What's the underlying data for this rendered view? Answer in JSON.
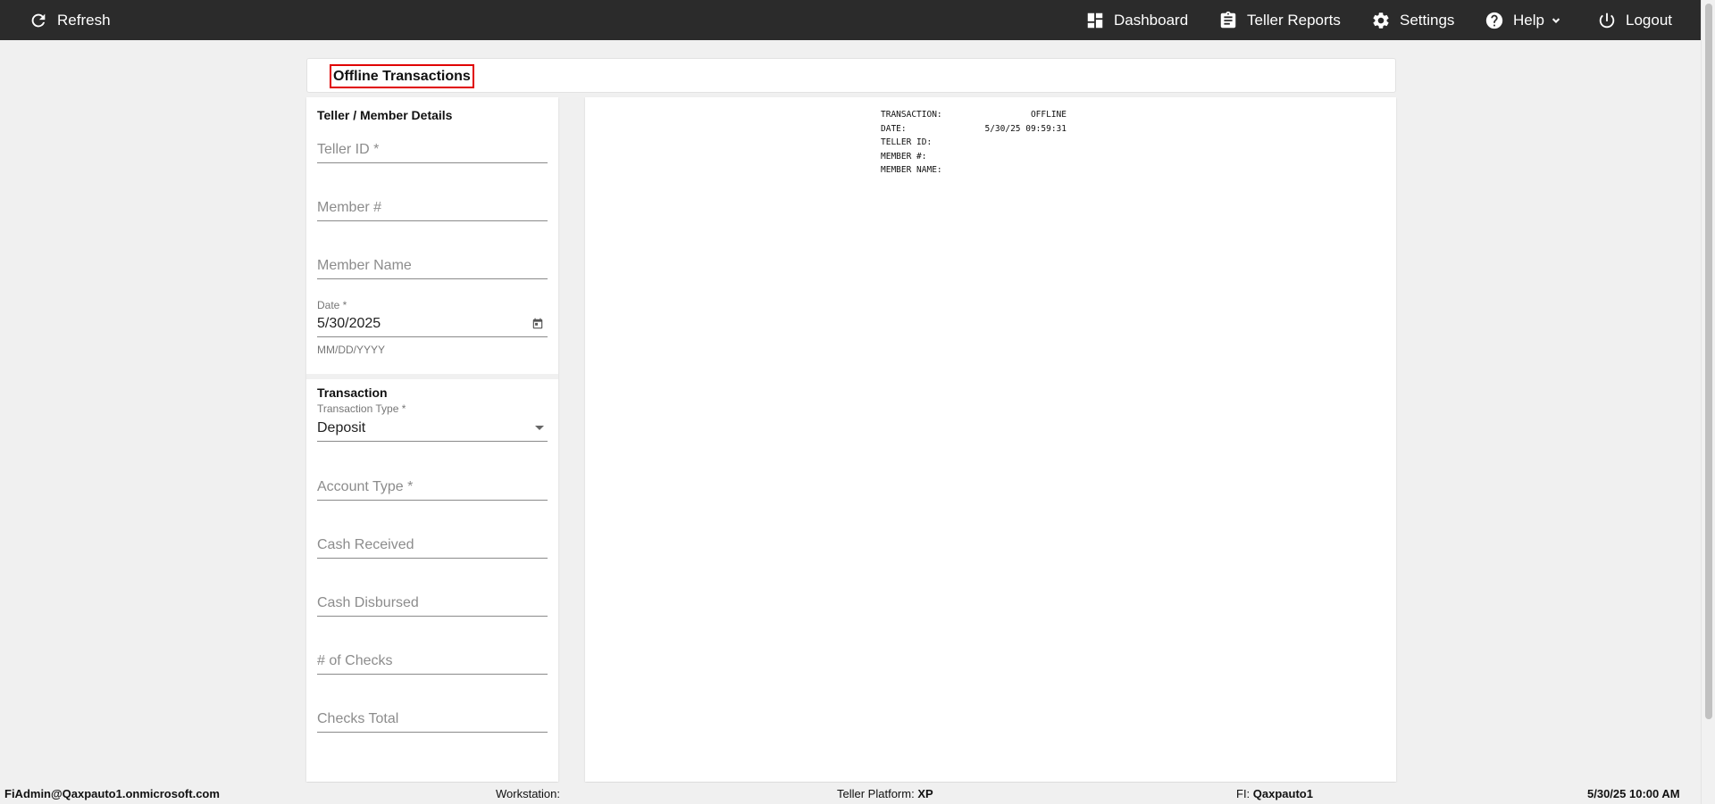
{
  "topbar": {
    "refresh_label": "Refresh",
    "nav": {
      "dashboard": "Dashboard",
      "teller_reports": "Teller Reports",
      "settings": "Settings",
      "help": "Help",
      "logout": "Logout"
    }
  },
  "page": {
    "title": "Offline Transactions"
  },
  "member_section": {
    "title": "Teller / Member Details",
    "teller_id_placeholder": "Teller ID *",
    "member_number_placeholder": "Member #",
    "member_name_placeholder": "Member Name",
    "date_label": "Date *",
    "date_value": "5/30/2025",
    "date_hint": "MM/DD/YYYY"
  },
  "transaction_section": {
    "title": "Transaction",
    "type_label": "Transaction Type *",
    "type_value": "Deposit",
    "account_type_placeholder": "Account Type *",
    "cash_received_placeholder": "Cash Received",
    "cash_disbursed_placeholder": "Cash Disbursed",
    "num_checks_placeholder": "# of Checks",
    "checks_total_placeholder": "Checks Total"
  },
  "receipt": {
    "rows": [
      {
        "key": "TRANSACTION:",
        "value": "OFFLINE"
      },
      {
        "key": "DATE:",
        "value": "5/30/25 09:59:31"
      },
      {
        "key": "TELLER ID:",
        "value": ""
      },
      {
        "key": "MEMBER #:",
        "value": ""
      },
      {
        "key": "MEMBER NAME:",
        "value": ""
      }
    ]
  },
  "statusbar": {
    "user": "FiAdmin@Qaxpauto1.onmicrosoft.com",
    "workstation_label": "Workstation:",
    "platform_label": "Teller Platform:",
    "platform_value": "XP",
    "fi_label": "FI:",
    "fi_value": "Qaxpauto1",
    "datetime": "5/30/25 10:00 AM"
  },
  "colors": {
    "topbar_bg": "#2b2b2b",
    "highlight_border": "#e00000",
    "page_bg": "#f0f0f0"
  }
}
